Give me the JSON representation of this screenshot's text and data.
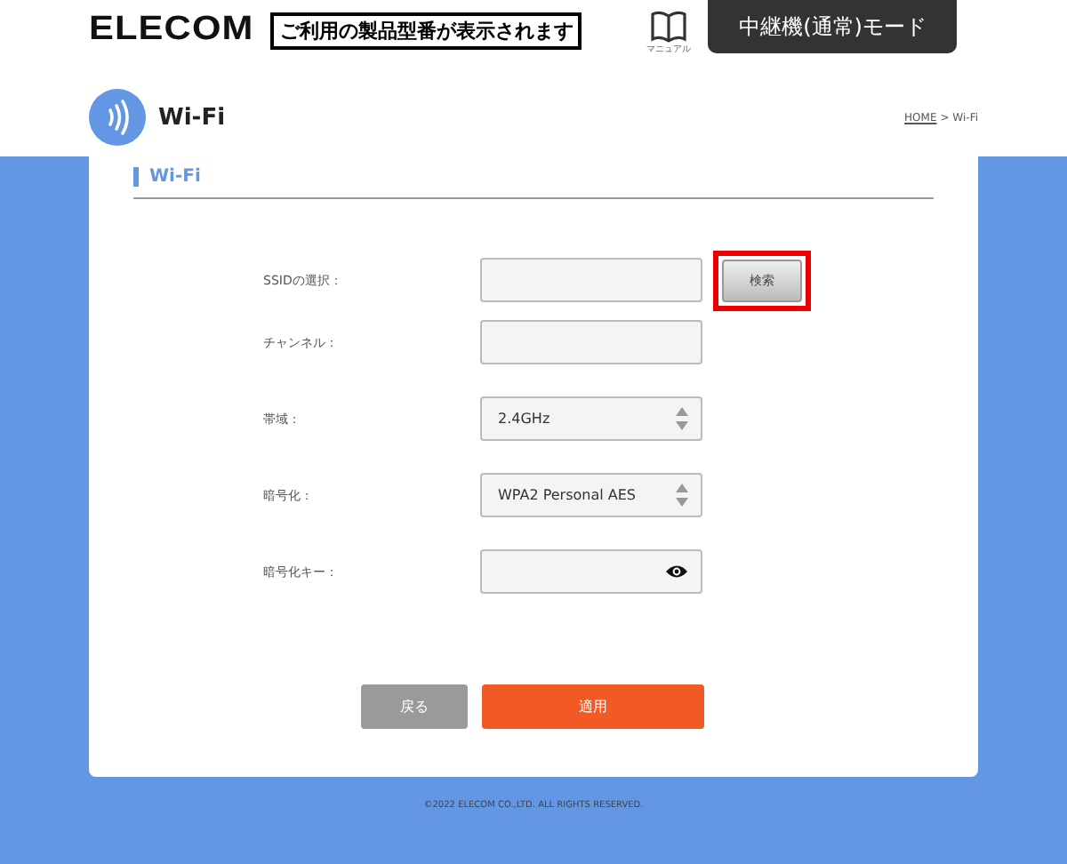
{
  "header": {
    "logo": "ELECOM",
    "model_notice": "ご利用の製品型番が表示されます",
    "manual_label": "マニュアル",
    "mode_button": "中継機(通常)モード"
  },
  "page": {
    "title": "Wi-Fi",
    "breadcrumb": [
      {
        "label": "HOME",
        "link": true
      },
      {
        "label": "> Wi-Fi",
        "link": false
      }
    ]
  },
  "section": {
    "title": "Wi-Fi"
  },
  "form": [
    {
      "label": "SSIDの選択：",
      "kind": "text",
      "button": "検索",
      "highlighted": true
    },
    {
      "label": "チャンネル：",
      "kind": "text"
    },
    {
      "label": "帯域：",
      "kind": "select",
      "value": "2.4GHz"
    },
    {
      "label": "暗号化：",
      "kind": "select",
      "value": "WPA2 Personal AES"
    },
    {
      "label": "暗号化キー：",
      "kind": "password"
    }
  ],
  "buttons": {
    "back": "戻る",
    "apply": "適用"
  },
  "footer": "©2022 ELECOM CO.,LTD. ALL RIGHTS RESERVED."
}
